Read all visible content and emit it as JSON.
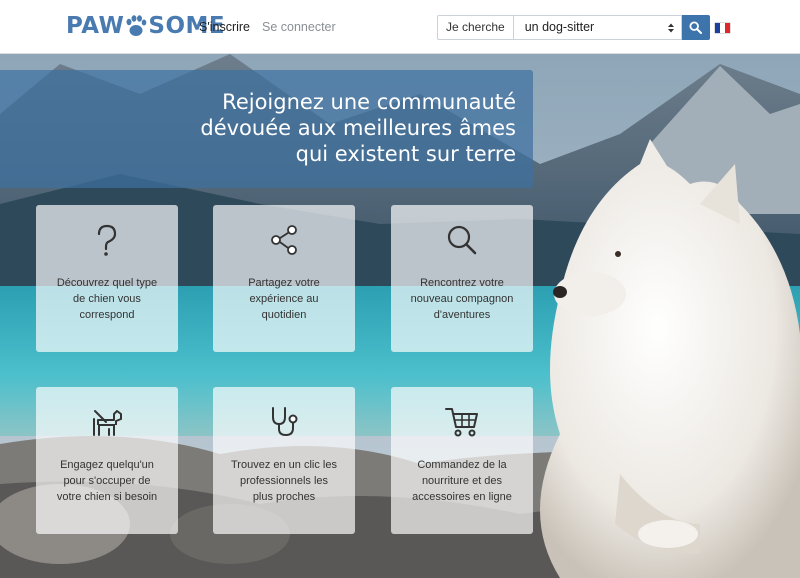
{
  "header": {
    "logo": {
      "part1": "PAW",
      "part2": "SOME"
    },
    "nav": {
      "signup": "S'inscrire",
      "login": "Se connecter"
    },
    "search": {
      "label": "Je cherche",
      "selected": "un dog-sitter",
      "button_icon": "search-icon"
    },
    "language_icon": "french-flag-icon"
  },
  "hero": {
    "title": "Rejoignez une communauté dévouée aux meilleures âmes qui existent sur terre",
    "title_lines": [
      "Rejoignez une communauté",
      "dévouée aux meilleures âmes",
      "qui existent sur terre"
    ]
  },
  "features": [
    {
      "icon": "question-icon",
      "lines": [
        "Découvrez quel type",
        "de chien vous",
        "correspond"
      ]
    },
    {
      "icon": "share-icon",
      "lines": [
        "Partagez votre",
        "expérience au",
        "quotidien"
      ]
    },
    {
      "icon": "search-icon",
      "lines": [
        "Rencontrez votre",
        "nouveau compagnon",
        "d'aventures"
      ]
    },
    {
      "icon": "dog-walker-icon",
      "lines": [
        "Engagez quelqu'un",
        "pour s'occuper de",
        "votre chien si besoin"
      ]
    },
    {
      "icon": "stethoscope-icon",
      "lines": [
        "Trouvez en un clic les",
        "professionnels les",
        "plus proches"
      ]
    },
    {
      "icon": "shopping-cart-icon",
      "lines": [
        "Commandez de la",
        "nourriture et des",
        "accessoires en ligne"
      ]
    }
  ],
  "colors": {
    "brand": "#4a7bb0",
    "accent": "#3d74ac",
    "overlay": "#3e70a0"
  }
}
